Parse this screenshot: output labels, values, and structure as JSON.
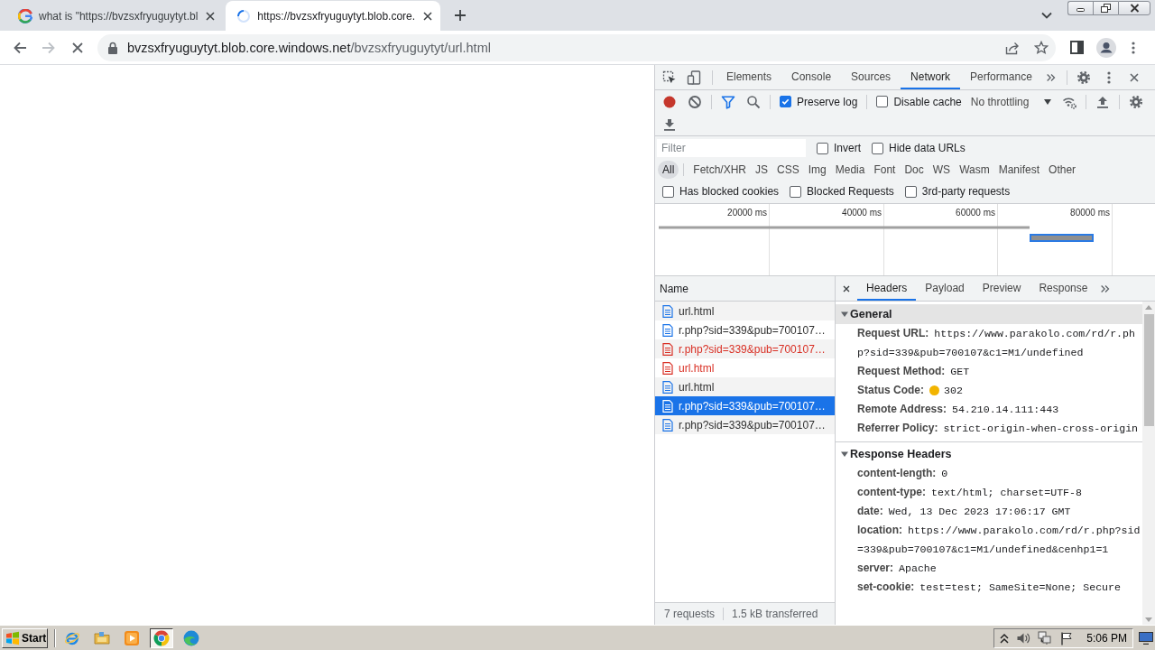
{
  "browser": {
    "tabs": [
      {
        "loading": false,
        "title": "what is \"https://bvzsxfryuguytyt.bl",
        "selected": false
      },
      {
        "loading": true,
        "title": "https://bvzsxfryuguytyt.blob.core.",
        "selected": true
      }
    ],
    "navigation": {
      "forward_disabled": true,
      "loading": true
    },
    "address": {
      "host": "bvzsxfryuguytyt.blob.core.windows.net",
      "path": "/bvzsxfryuguytyt/url.html"
    }
  },
  "devtools": {
    "panel_tabs": [
      {
        "label": "Elements",
        "selected": false
      },
      {
        "label": "Console",
        "selected": false
      },
      {
        "label": "Sources",
        "selected": false
      },
      {
        "label": "Network",
        "selected": true
      },
      {
        "label": "Performance",
        "selected": false
      }
    ],
    "recording": true,
    "preserve_log": {
      "label": "Preserve log",
      "checked": true
    },
    "disable_cache": {
      "label": "Disable cache",
      "checked": false
    },
    "throttling": "No throttling",
    "filter": {
      "placeholder": "Filter"
    },
    "filter_options": [
      {
        "label": "Invert",
        "checked": false
      },
      {
        "label": "Hide data URLs",
        "checked": false
      }
    ],
    "resource_types": [
      {
        "label": "All",
        "selected": true
      },
      {
        "label": "Fetch/XHR",
        "selected": false
      },
      {
        "label": "JS",
        "selected": false
      },
      {
        "label": "CSS",
        "selected": false
      },
      {
        "label": "Img",
        "selected": false
      },
      {
        "label": "Media",
        "selected": false
      },
      {
        "label": "Font",
        "selected": false
      },
      {
        "label": "Doc",
        "selected": false
      },
      {
        "label": "WS",
        "selected": false
      },
      {
        "label": "Wasm",
        "selected": false
      },
      {
        "label": "Manifest",
        "selected": false
      },
      {
        "label": "Other",
        "selected": false
      }
    ],
    "request_options": [
      {
        "label": "Has blocked cookies",
        "checked": false
      },
      {
        "label": "Blocked Requests",
        "checked": false
      },
      {
        "label": "3rd-party requests",
        "checked": false
      }
    ],
    "overview": {
      "ticks": [
        "20000 ms",
        "40000 ms",
        "60000 ms",
        "80000 ms"
      ]
    },
    "requests": {
      "column": "Name",
      "rows": [
        {
          "name": "url.html",
          "failed": false,
          "selected": false
        },
        {
          "name": "r.php?sid=339&pub=700107…",
          "failed": false,
          "selected": false
        },
        {
          "name": "r.php?sid=339&pub=700107…",
          "failed": true,
          "selected": false
        },
        {
          "name": "url.html",
          "failed": true,
          "selected": false
        },
        {
          "name": "url.html",
          "failed": false,
          "selected": false
        },
        {
          "name": "r.php?sid=339&pub=700107…",
          "failed": false,
          "selected": true
        },
        {
          "name": "r.php?sid=339&pub=700107…",
          "failed": false,
          "selected": false
        }
      ]
    },
    "summary": [
      "7 requests",
      "1.5 kB transferred"
    ],
    "detail_tabs": [
      {
        "label": "Headers",
        "selected": true
      },
      {
        "label": "Payload",
        "selected": false
      },
      {
        "label": "Preview",
        "selected": false
      },
      {
        "label": "Response",
        "selected": false
      }
    ],
    "sections": [
      {
        "title": "General",
        "expanded": true,
        "rows": [
          {
            "kind": "plain",
            "name": "Request URL:",
            "value": "https://www.parakolo.com/rd/r.php?sid=339&pub=700107&c1=M1/undefined"
          },
          {
            "kind": "plain",
            "name": "Request Method:",
            "value": "GET"
          },
          {
            "kind": "status",
            "name": "Status Code:",
            "value": "302"
          },
          {
            "kind": "plain",
            "name": "Remote Address:",
            "value": "54.210.14.111:443"
          },
          {
            "kind": "plain",
            "name": "Referrer Policy:",
            "value": "strict-origin-when-cross-origin"
          }
        ]
      },
      {
        "title": "Response Headers",
        "expanded": true,
        "rows": [
          {
            "kind": "plain",
            "name": "content-length:",
            "value": "0"
          },
          {
            "kind": "plain",
            "name": "content-type:",
            "value": "text/html; charset=UTF-8"
          },
          {
            "kind": "plain",
            "name": "date:",
            "value": "Wed, 13 Dec 2023 17:06:17 GMT"
          },
          {
            "kind": "plain",
            "name": "location:",
            "value": "https://www.parakolo.com/rd/r.php?sid=339&pub=700107&c1=M1/undefined&cenhp1=1"
          },
          {
            "kind": "plain",
            "name": "server:",
            "value": "Apache"
          },
          {
            "kind": "plain",
            "name": "set-cookie:",
            "value": "test=test; SameSite=None; Secure"
          }
        ]
      }
    ]
  },
  "taskbar": {
    "start": "Start",
    "apps": [
      {
        "kind": "globe-orbit",
        "pressed": false
      },
      {
        "kind": "folder",
        "pressed": false
      },
      {
        "kind": "play-tile",
        "pressed": false
      },
      {
        "kind": "circle-logo",
        "pressed": true
      },
      {
        "kind": "wave-logo",
        "pressed": false
      }
    ],
    "clock": "5:06 PM"
  }
}
